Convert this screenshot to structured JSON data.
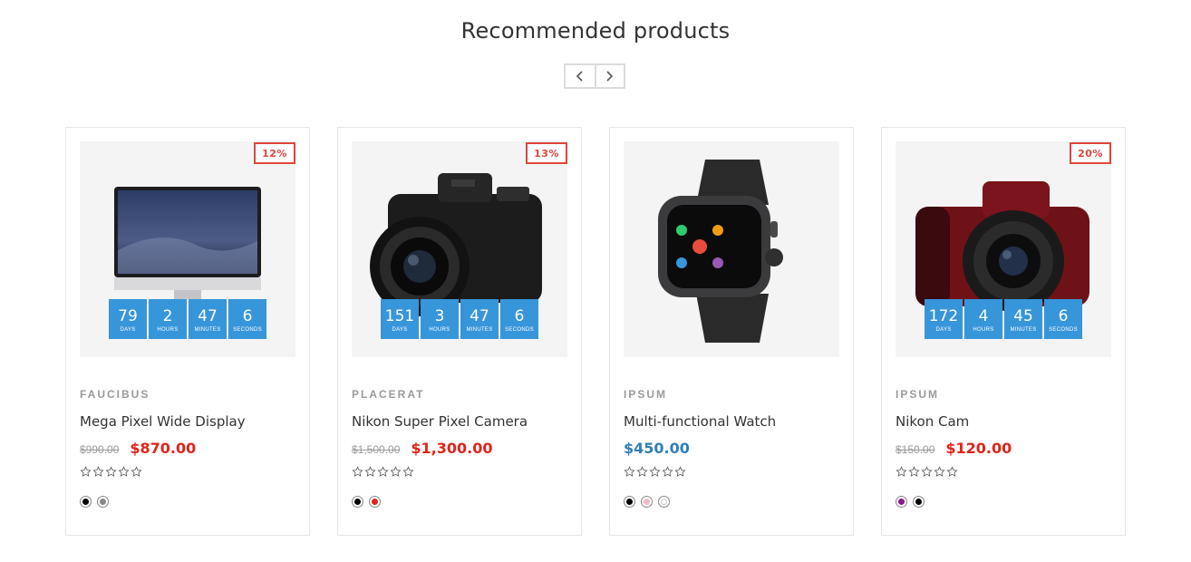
{
  "section": {
    "title": "Recommended products"
  },
  "nav": {
    "prev_icon": "chevron-left-icon",
    "next_icon": "chevron-right-icon"
  },
  "countdown_labels": {
    "days": "DAYS",
    "hours": "HOURS",
    "minutes": "MINUTES",
    "seconds": "SECONDS"
  },
  "products": [
    {
      "discount": "12%",
      "brand": "FAUCIBUS",
      "name": "Mega Pixel Wide Display",
      "old_price": "$990.00",
      "price": "$870.00",
      "countdown": {
        "days": "79",
        "hours": "2",
        "minutes": "47",
        "seconds": "6"
      },
      "rating": 0,
      "swatches": [
        "#000000",
        "#888888"
      ]
    },
    {
      "discount": "13%",
      "brand": "PLACERAT",
      "name": "Nikon Super Pixel Camera",
      "old_price": "$1,500.00",
      "price": "$1,300.00",
      "countdown": {
        "days": "151",
        "hours": "3",
        "minutes": "47",
        "seconds": "6"
      },
      "rating": 0,
      "swatches": [
        "#000000",
        "#e2231a"
      ]
    },
    {
      "brand": "IPSUM",
      "name": "Multi-functional Watch",
      "price": "$450.00",
      "rating": 0,
      "swatches": [
        "#000000",
        "#f2b8c6",
        "#ffffff"
      ]
    },
    {
      "discount": "20%",
      "brand": "IPSUM",
      "name": "Nikon Cam",
      "old_price": "$150.00",
      "price": "$120.00",
      "countdown": {
        "days": "172",
        "hours": "4",
        "minutes": "45",
        "seconds": "6"
      },
      "rating": 0,
      "swatches": [
        "#8b1a8b",
        "#000000"
      ]
    }
  ],
  "colors": {
    "accent_blue": "#3795da",
    "sale_red": "#e2231a",
    "badge_red": "#e0443a",
    "regular_price_blue": "#2f7fb6"
  }
}
